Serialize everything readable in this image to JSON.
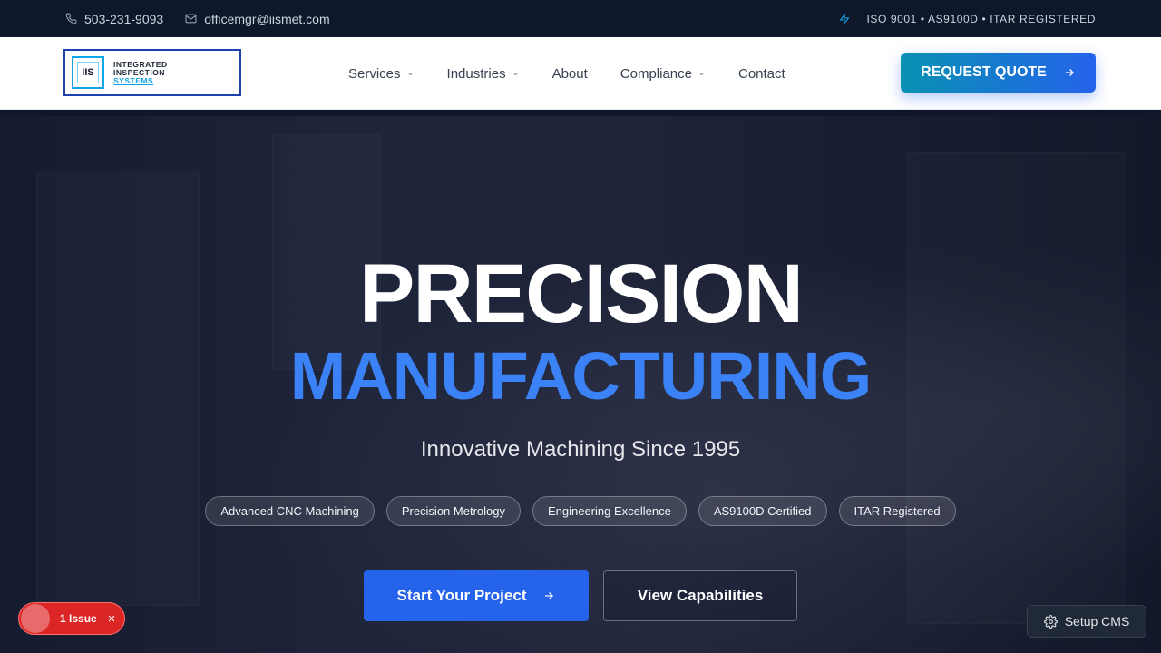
{
  "topbar": {
    "phone": "503-231-9093",
    "email": "officemgr@iismet.com",
    "certifications": "ISO 9001 • AS9100D • ITAR REGISTERED"
  },
  "logo": {
    "mark": "IIS",
    "line1": "INTEGRATED",
    "line2": "INSPECTION",
    "line3": "SYSTEMS"
  },
  "nav": {
    "items": [
      {
        "label": "Services",
        "dropdown": true
      },
      {
        "label": "Industries",
        "dropdown": true
      },
      {
        "label": "About",
        "dropdown": false
      },
      {
        "label": "Compliance",
        "dropdown": true
      },
      {
        "label": "Contact",
        "dropdown": false
      }
    ],
    "cta": "REQUEST QUOTE"
  },
  "hero": {
    "title_line1": "PRECISION",
    "title_line2": "MANUFACTURING",
    "subtitle": "Innovative Machining Since 1995",
    "tags": [
      "Advanced CNC Machining",
      "Precision Metrology",
      "Engineering Excellence",
      "AS9100D Certified",
      "ITAR Registered"
    ],
    "primary_button": "Start Your Project",
    "secondary_button": "View Capabilities"
  },
  "widgets": {
    "issues_label": "1 Issue",
    "cms_label": "Setup CMS"
  },
  "colors": {
    "accent": "#2563eb",
    "accent_cyan": "#0891b2",
    "title_blue": "#3b82f6",
    "issue_red": "#dc2626"
  }
}
